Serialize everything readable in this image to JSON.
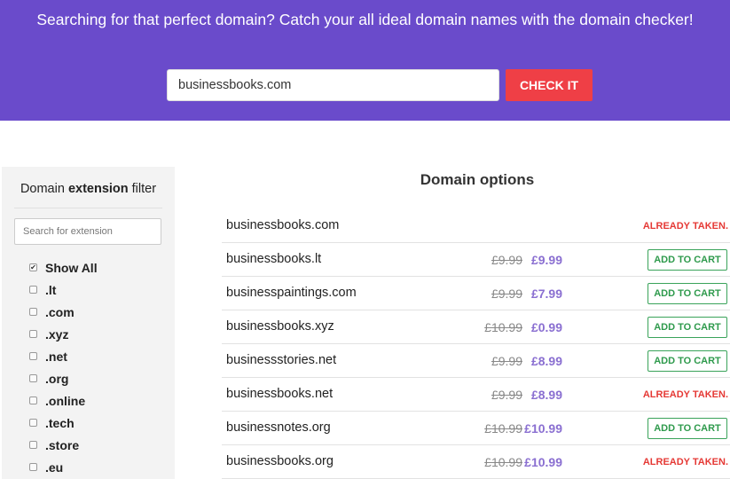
{
  "hero": {
    "headline": "Searching for that perfect domain? Catch your all ideal domain names with the domain checker!",
    "search_value": "businessbooks.com",
    "check_label": "CHECK IT",
    "background_color": "#6a4bcb",
    "button_color": "#ef3f46"
  },
  "sidebar": {
    "title_prefix": "Domain ",
    "title_bold": "extension",
    "title_suffix": " filter",
    "search_placeholder": "Search for extension",
    "filters": [
      {
        "label": "Show All",
        "checked": true
      },
      {
        "label": ".lt",
        "checked": false
      },
      {
        "label": ".com",
        "checked": false
      },
      {
        "label": ".xyz",
        "checked": false
      },
      {
        "label": ".net",
        "checked": false
      },
      {
        "label": ".org",
        "checked": false
      },
      {
        "label": ".online",
        "checked": false
      },
      {
        "label": ".tech",
        "checked": false
      },
      {
        "label": ".store",
        "checked": false
      },
      {
        "label": ".eu",
        "checked": false
      }
    ]
  },
  "options": {
    "title": "Domain options",
    "add_label": "ADD TO CART",
    "taken_label": "ALREADY TAKEN.",
    "rows": [
      {
        "domain": "businessbooks.com",
        "old_price": "",
        "new_price": "",
        "status": "taken"
      },
      {
        "domain": "businessbooks.lt",
        "old_price": "£9.99",
        "new_price": "£9.99",
        "status": "available"
      },
      {
        "domain": "businesspaintings.com",
        "old_price": "£9.99",
        "new_price": "£7.99",
        "status": "available"
      },
      {
        "domain": "businessbooks.xyz",
        "old_price": "£10.99",
        "new_price": "£0.99",
        "status": "available"
      },
      {
        "domain": "businessstories.net",
        "old_price": "£9.99",
        "new_price": "£8.99",
        "status": "available"
      },
      {
        "domain": "businessbooks.net",
        "old_price": "£9.99",
        "new_price": "£8.99",
        "status": "taken"
      },
      {
        "domain": "businessnotes.org",
        "old_price": "£10.99",
        "new_price": "£10.99",
        "status": "available"
      },
      {
        "domain": "businessbooks.org",
        "old_price": "£10.99",
        "new_price": "£10.99",
        "status": "taken"
      }
    ]
  },
  "colors": {
    "price_accent": "#8a6fd1",
    "available_green": "#2e9a4c",
    "taken_red": "#e53935"
  }
}
